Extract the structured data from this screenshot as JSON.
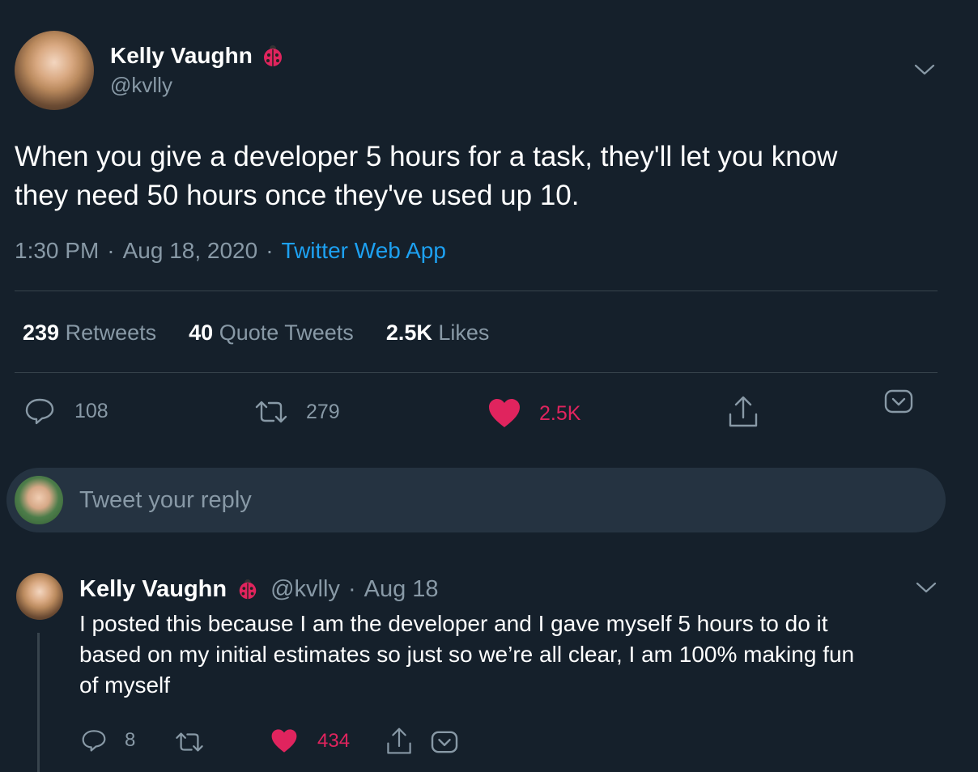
{
  "tweet": {
    "author_name": "Kelly Vaughn",
    "author_handle": "@kvlly",
    "text_line1": "When you give a developer 5 hours for a task, they'll let you know",
    "text_line2": "they need 50 hours once they've used up 10.",
    "time": "1:30 PM",
    "sep1": "·",
    "date": "Aug 18, 2020",
    "sep2": "·",
    "source": "Twitter Web App",
    "stats": {
      "retweets_count": "239",
      "retweets_label": "Retweets",
      "quotes_count": "40",
      "quotes_label": "Quote Tweets",
      "likes_count": "2.5K",
      "likes_label": "Likes"
    },
    "actions": {
      "reply_count": "108",
      "retweet_count": "279",
      "like_count": "2.5K"
    }
  },
  "compose": {
    "placeholder": "Tweet your reply"
  },
  "reply": {
    "author_name": "Kelly Vaughn",
    "author_handle": "@kvlly",
    "sep": "·",
    "date": "Aug 18",
    "line1": "I posted this because I am the developer and I gave myself 5 hours to do it",
    "line2": "based on my initial estimates so just so we’re all clear, I am 100% making fun",
    "line3": "of myself",
    "reply_count": "8",
    "like_count": "434"
  },
  "colors": {
    "background": "#15202b",
    "accent_blue": "#1da1f2",
    "like_red": "#e0245e",
    "muted": "#8899a6",
    "divider": "#38444d"
  },
  "icons": [
    "ladybug-icon",
    "chevron-down-icon",
    "reply-icon",
    "retweet-icon",
    "heart-icon",
    "share-icon",
    "bookmark-icon"
  ]
}
